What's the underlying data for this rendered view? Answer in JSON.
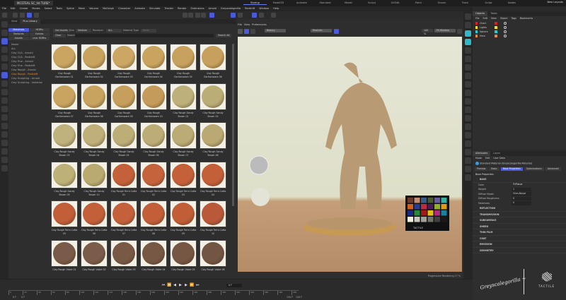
{
  "window": {
    "doc_tab": "MCSTEAL SC_Vd TURE*",
    "layouts": [
      "Startup",
      "Model3D",
      "Animate",
      "Standard",
      "Model",
      "Sculpt",
      "UVEdit",
      "Paint",
      "Groom",
      "Track",
      "Script",
      "Nodes"
    ],
    "active_layout": "Startup",
    "new_layouts": "New Layouts"
  },
  "menu": [
    "File",
    "Edit",
    "Create",
    "Modes",
    "Select",
    "Tools",
    "Spline",
    "Mesh",
    "Volume",
    "MoGraph",
    "Character",
    "Animate",
    "Simulate",
    "Tracker",
    "Render",
    "Extensions",
    "Arnold",
    "Greyscalegorilla",
    "Redshift",
    "Window",
    "Help"
  ],
  "browser": {
    "tabs": [
      "View",
      "Plus Library"
    ],
    "active_tab": "Plus Library",
    "categories": [
      "Materials",
      "HDRIs",
      "Textures",
      "Extras",
      "Assets",
      "Live HDRIs"
    ],
    "active_category": "Materials",
    "tree_header": "Name",
    "tree": [
      "ALL",
      "Clay Cl/A - Arnold",
      "Clay Cl/A - Redshift",
      "Clay Fine - Arnold",
      "Clay Fine - Redshift",
      "Clay Rough - Arnold",
      "Clay Rough - Redshift",
      "Clay Sculpting - Arnold",
      "Clay Sculpting - Variation"
    ],
    "selected_tree": "Clay Rough - Redshift",
    "get_assets": "Get Assets",
    "size_label": "Size",
    "size_value": "Medium",
    "renderer_label": "Renderer",
    "renderer_value": "ALL",
    "material_type_label": "Material Type",
    "material_type_value": "None",
    "clear": "Clear",
    "search_label": "Search",
    "search_value": "",
    "search_all": "Search All",
    "materials": [
      {
        "name": "Clay Rough\nEarthenware 01",
        "color": "#c9a561"
      },
      {
        "name": "Clay Rough\nEarthenware 02",
        "color": "#c8a35e"
      },
      {
        "name": "Clay Rough\nEarthenware 03",
        "color": "#cba763"
      },
      {
        "name": "Clay Rough\nEarthenware 04",
        "color": "#c9a45f"
      },
      {
        "name": "Clay Rough\nEarthenware 05",
        "color": "#c7a25e"
      },
      {
        "name": "Clay Rough\nEarthenware 06",
        "color": "#c6a05c"
      },
      {
        "name": "Clay Rough\nEarthenware 07",
        "color": "#c9a460"
      },
      {
        "name": "Clay Rough\nEarthenware 08",
        "color": "#c7a35f"
      },
      {
        "name": "Clay Rough\nEarthenware 09",
        "color": "#c69f5c"
      },
      {
        "name": "Clay Rough\nEarthenware 10",
        "color": "#c49b5a"
      },
      {
        "name": "Clay Rough Sandy\nBrown 01",
        "color": "#bdb07a"
      },
      {
        "name": "Clay Rough Sandy\nBrown 02",
        "color": "#bbad76"
      },
      {
        "name": "Clay Rough Sandy\nBrown 03",
        "color": "#c0b27c"
      },
      {
        "name": "Clay Rough Sandy\nBrown 04",
        "color": "#bfb079"
      },
      {
        "name": "Clay Rough Sandy\nBrown 05",
        "color": "#bdae77"
      },
      {
        "name": "Clay Rough Sandy\nBrown 06",
        "color": "#bcad76"
      },
      {
        "name": "Clay Rough Sandy\nBrown 07",
        "color": "#bbab74"
      },
      {
        "name": "Clay Rough Sandy\nBrown 08",
        "color": "#baa972"
      },
      {
        "name": "Clay Rough Sandy\nBrown 09",
        "color": "#bdb178"
      },
      {
        "name": "Clay Rough Sandy\nBrown 10",
        "color": "#b9ab70"
      },
      {
        "name": "Clay Rough Terra Cotta\n01",
        "color": "#c4603a"
      },
      {
        "name": "Clay Rough Terra Cotta\n02",
        "color": "#c5633c"
      },
      {
        "name": "Clay Rough Terra Cotta\n03",
        "color": "#c4613a"
      },
      {
        "name": "Clay Rough Terra Cotta\n04",
        "color": "#c35f39"
      },
      {
        "name": "Clay Rough Terra Cotta\n05",
        "color": "#c25e38"
      },
      {
        "name": "Clay Rough Terra Cotta\n06",
        "color": "#c3603a"
      },
      {
        "name": "Clay Rough Terra Cotta\n07",
        "color": "#c4613b"
      },
      {
        "name": "Clay Rough Terra Cotta\n08",
        "color": "#c25f39"
      },
      {
        "name": "Clay Rough Terra Cotta\n09",
        "color": "#c15d37"
      },
      {
        "name": "Clay Rough Terra Cotta\n10",
        "color": "#b9593a"
      },
      {
        "name": "Clay Rough Violet 01",
        "color": "#7a5a48"
      },
      {
        "name": "Clay Rough Violet 02",
        "color": "#7b5b49"
      },
      {
        "name": "Clay Rough Violet 03",
        "color": "#785946"
      },
      {
        "name": "Clay Rough Violet 04",
        "color": "#775845"
      },
      {
        "name": "Clay Rough Violet 05",
        "color": "#765744"
      },
      {
        "name": "Clay Rough Violet 06",
        "color": "#735543"
      }
    ]
  },
  "viewport": {
    "menu": [
      "File",
      "View",
      "Preferences"
    ],
    "render_mode": "Beauty",
    "camera": "Realistic",
    "zoom": "100 %",
    "resolution": "Fit Window",
    "status": "Progressive Rendering",
    "progress_percent": 17,
    "chart_brand": "TACTILE"
  },
  "objects": {
    "tabs": [
      "Objects",
      "Takes"
    ],
    "menu": [
      "File",
      "Edit",
      "View",
      "Object",
      "Tags",
      "Bookmarks"
    ],
    "items": [
      {
        "name": "Chart",
        "color": "#e21d1d"
      },
      {
        "name": "Lights",
        "color": "#f5e000"
      },
      {
        "name": "Sphere",
        "color": "#19d4d4"
      },
      {
        "name": "Hero",
        "color": "#e8874a"
      }
    ]
  },
  "attributes": {
    "tabs": [
      "Attributes",
      "Layer"
    ],
    "menu": [
      "Mode",
      "Edit",
      "User Data"
    ],
    "material_title": "Standard Material (Greyscalegorilla Material)",
    "subtabs": [
      "Preview",
      "Basic",
      "Base Properties",
      "Optimizations",
      "Advanced"
    ],
    "active_subtab": "Base Properties",
    "section_title": "Base Properties",
    "group": "BASE",
    "rows": [
      {
        "label": "Color",
        "value": "TriPlanar"
      },
      {
        "label": "Weight",
        "value": "1"
      },
      {
        "label": "Diffuse Model",
        "value": "Oren-Nayar"
      },
      {
        "label": "Diffuse Roughness",
        "value": "0"
      },
      {
        "label": "Metalness",
        "value": "0"
      }
    ],
    "sections": [
      "REFLECTION",
      "TRANSMISSION",
      "SUBSURFACE",
      "SHEEN",
      "THIN FILM",
      "COAT",
      "EMISSION",
      "GEOMETRY"
    ]
  },
  "timeline": {
    "current_frame": "0 F",
    "start": "0 F",
    "start2": "0 F",
    "end": "120 F",
    "end2": "120 F",
    "ticks": [
      "0",
      "20",
      "40",
      "60",
      "80",
      "100",
      "120",
      "140",
      "160",
      "180",
      "200",
      "220",
      "240",
      "260",
      "280",
      "300",
      "320",
      "340",
      "360",
      "380",
      "400"
    ]
  },
  "brand": {
    "left": "Greyscalegorilla",
    "right": "TACTILE"
  }
}
